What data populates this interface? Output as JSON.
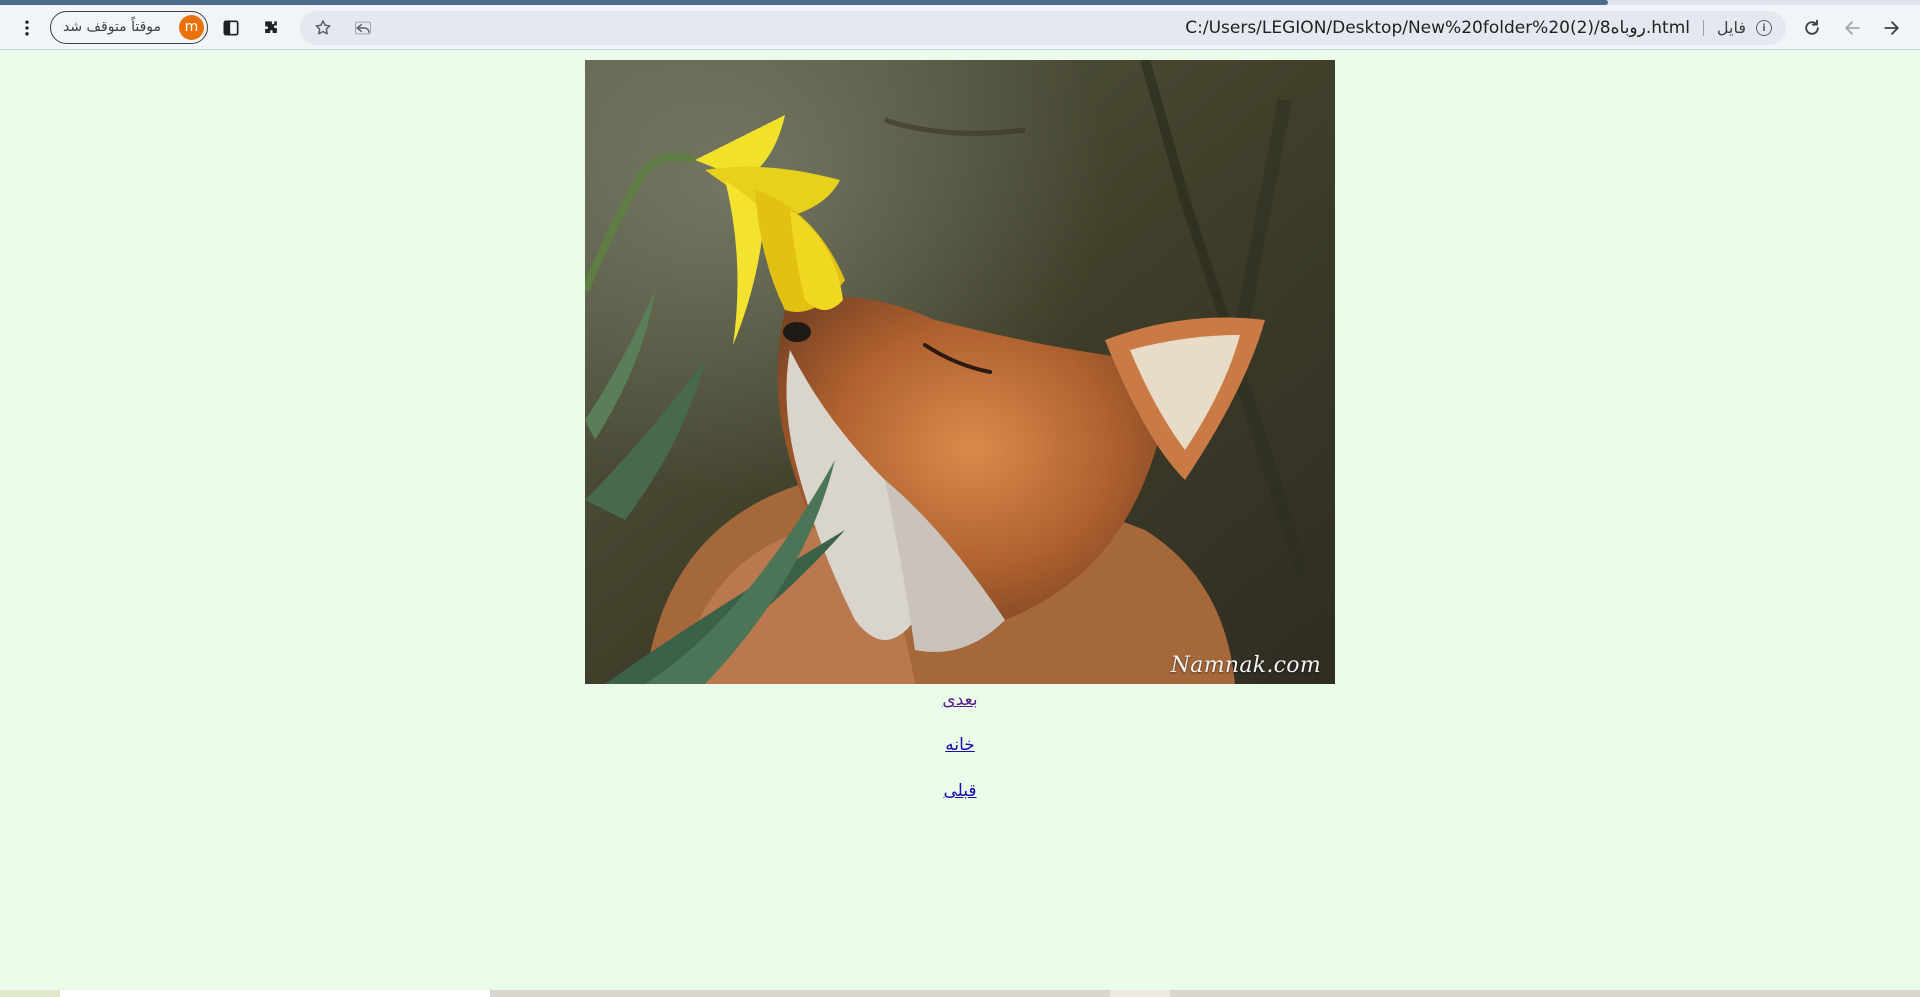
{
  "browser": {
    "url": "C:/Users/LEGION/Desktop/New%20folder%20(2)/روباه8.html",
    "url_scheme_label": "فایل",
    "profile_status": "موقتاً متوقف شد",
    "profile_initial": "m",
    "colors": {
      "profile_avatar": "#e8710a",
      "page_background": "#eafbe9"
    }
  },
  "page": {
    "image": {
      "subject": "fox-smelling-daffodil",
      "watermark": "Namnak.com"
    },
    "links": {
      "next": "بعدی",
      "home": "خانه",
      "previous": "قبلی"
    }
  }
}
